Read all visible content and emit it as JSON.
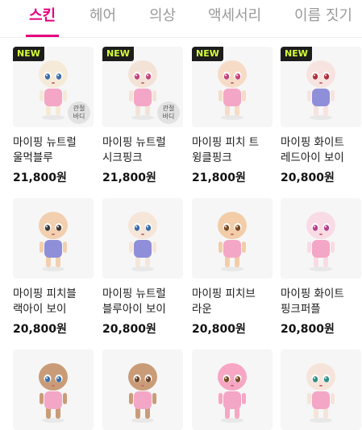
{
  "tabs": [
    "스킨",
    "헤어",
    "의상",
    "액세서리",
    "이름 짓기"
  ],
  "products": [
    {
      "name_line1": "마이핑 뉴트럴",
      "name_line2": "울먹블루",
      "price": "21,800원",
      "badge": "NEW",
      "extra": "관절\n바디",
      "skin": "#f5ead8",
      "eye": "#3d6ea8",
      "outfit": "#f4a6c6"
    },
    {
      "name_line1": "마이핑 뉴트럴",
      "name_line2": "시크핑크",
      "price": "21,800원",
      "badge": "NEW",
      "extra": "관절\n바디",
      "skin": "#f3e3d6",
      "eye": "#c6447e",
      "outfit": "#f4a6c6"
    },
    {
      "name_line1": "마이핑 피치 트",
      "name_line2": "윙클핑크",
      "price": "21,800원",
      "badge": "NEW",
      "extra": "",
      "skin": "#f6dcc7",
      "eye": "#c6447e",
      "outfit": "#f4a6c6"
    },
    {
      "name_line1": "마이핑 화이트",
      "name_line2": "레드아이 보이",
      "price": "20,800원",
      "badge": "NEW",
      "extra": "",
      "skin": "#f7e3e0",
      "eye": "#b0303a",
      "outfit": "#8f8ed8"
    },
    {
      "name_line1": "마이핑 피치블",
      "name_line2": "랙아이 보이",
      "price": "20,800원",
      "badge": "",
      "extra": "",
      "skin": "#f2cfae",
      "eye": "#3a3a3a",
      "outfit": "#8f8ed8"
    },
    {
      "name_line1": "마이핑 뉴트럴",
      "name_line2": "블루아이 보이",
      "price": "20,800원",
      "badge": "",
      "extra": "",
      "skin": "#f5e6d8",
      "eye": "#3d6ea8",
      "outfit": "#8f8ed8"
    },
    {
      "name_line1": "마이핑 피치브",
      "name_line2": "라운",
      "price": "20,800원",
      "badge": "",
      "extra": "",
      "skin": "#f2cda8",
      "eye": "#7a4b24",
      "outfit": "#f4a6c6"
    },
    {
      "name_line1": "마이핑 화이트",
      "name_line2": "핑크퍼플",
      "price": "20,800원",
      "badge": "",
      "extra": "",
      "skin": "#f9dbe5",
      "eye": "#b4418a",
      "outfit": "#f4a6c6"
    }
  ],
  "partial_row": [
    {
      "skin": "#c99c77",
      "eye": "#3d6ea8"
    },
    {
      "skin": "#c99c77",
      "eye": "#6a4126"
    },
    {
      "skin": "#f7a6c4",
      "eye": "#7a4b24"
    },
    {
      "skin": "#f6e4da",
      "eye": "#2f8f86"
    }
  ]
}
